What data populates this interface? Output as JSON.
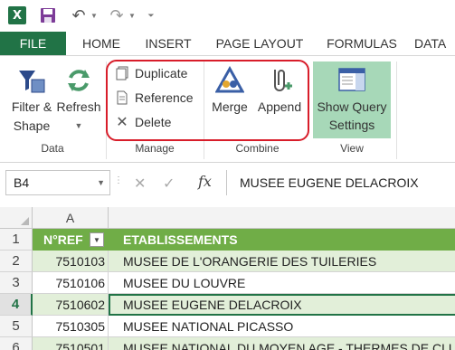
{
  "titlebar": {
    "app_logo": "X",
    "icons": [
      "excel-logo-icon",
      "save-icon",
      "undo-icon",
      "redo-icon",
      "customize-qat-icon"
    ]
  },
  "tabs": [
    {
      "label": "FILE",
      "active": true
    },
    {
      "label": "HOME"
    },
    {
      "label": "INSERT"
    },
    {
      "label": "PAGE LAYOUT"
    },
    {
      "label": "FORMULAS"
    },
    {
      "label": "DATA"
    }
  ],
  "ribbon": {
    "data_group": {
      "label": "Data",
      "filter_shape": {
        "line1": "Filter &",
        "line2": "Shape"
      },
      "refresh": {
        "line1": "Refresh"
      }
    },
    "manage_group": {
      "label": "Manage",
      "duplicate": "Duplicate",
      "reference": "Reference",
      "delete": "Delete"
    },
    "combine_group": {
      "label": "Combine",
      "merge": "Merge",
      "append": "Append"
    },
    "view_group": {
      "label": "View",
      "show_query": {
        "line1": "Show Query",
        "line2": "Settings"
      }
    }
  },
  "formula_bar": {
    "name_box": "B4",
    "fx": "fx",
    "content": "MUSEE EUGENE DELACROIX"
  },
  "grid": {
    "column_a": "A",
    "rows": [
      {
        "num": "1",
        "a": "N°REF",
        "b": "ETABLISSEMENTS"
      },
      {
        "num": "2",
        "a": "7510103",
        "b": "MUSEE DE L'ORANGERIE DES TUILERIES"
      },
      {
        "num": "3",
        "a": "7510106",
        "b": "MUSEE DU LOUVRE"
      },
      {
        "num": "4",
        "a": "7510602",
        "b": "MUSEE EUGENE DELACROIX"
      },
      {
        "num": "5",
        "a": "7510305",
        "b": "MUSEE NATIONAL PICASSO"
      },
      {
        "num": "6",
        "a": "7510501",
        "b": "MUSEE NATIONAL DU MOYEN AGE - THERMES DE CLUNY"
      }
    ]
  },
  "colors": {
    "excel_green": "#217346",
    "table_header_green": "#70ad47",
    "band_green": "#e2efd9",
    "annotation_red": "#d81d2a",
    "show_query_bg": "#a7d8b8"
  }
}
